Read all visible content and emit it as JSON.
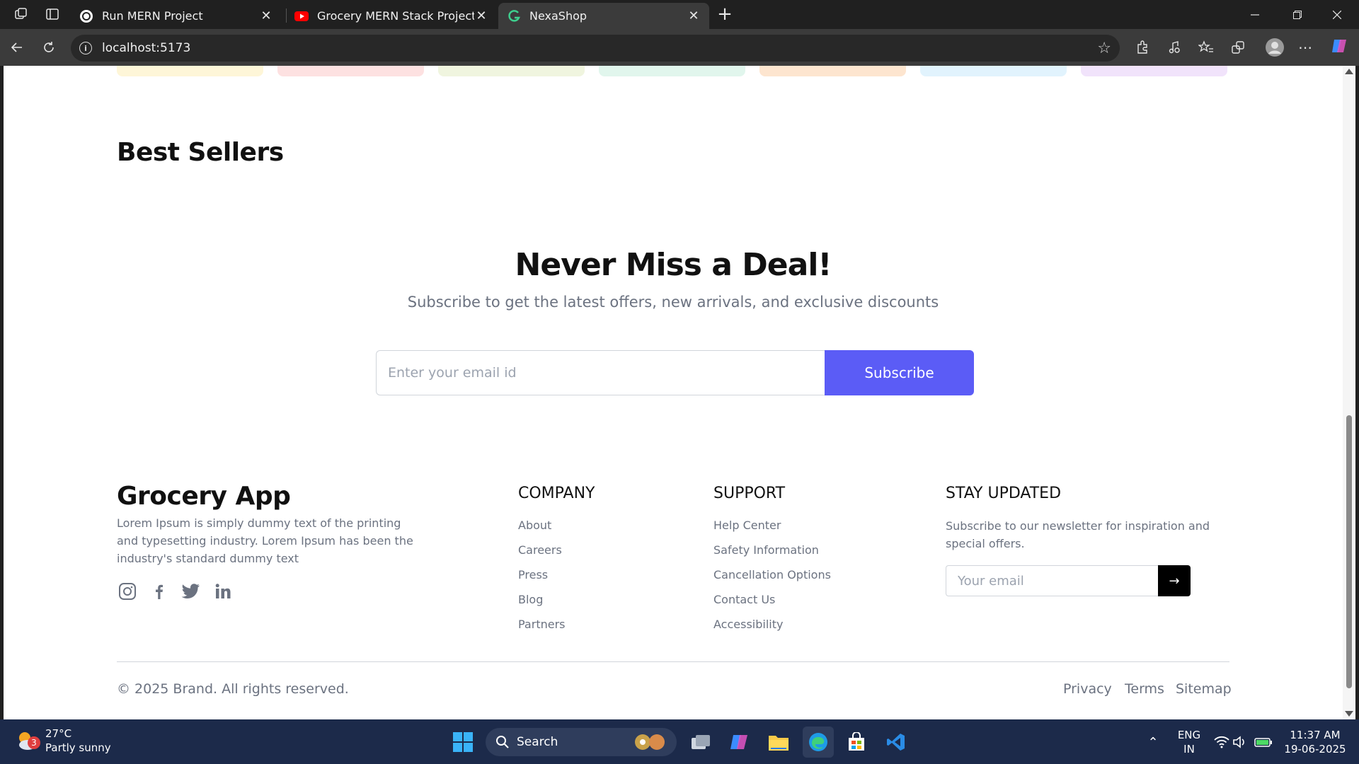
{
  "browser": {
    "tabs": [
      {
        "title": "Run MERN Project",
        "icon": "chatgpt-icon"
      },
      {
        "title": "Grocery MERN Stack Project Full",
        "icon": "youtube-icon"
      },
      {
        "title": "NexaShop",
        "icon": "nexashop-icon",
        "active": true
      }
    ],
    "url": "localhost:5173"
  },
  "page": {
    "best_sellers_heading": "Best Sellers",
    "newsletter": {
      "heading": "Never Miss a Deal!",
      "subheading": "Subscribe to get the latest offers, new arrivals, and exclusive discounts",
      "email_placeholder": "Enter your email id",
      "subscribe_label": "Subscribe",
      "accent_color": "#5b5cf6"
    },
    "category_card_colors": [
      "#fef6d8",
      "#fde1e1",
      "#f0f5df",
      "#e1f6ed",
      "#fde5cf",
      "#e1f3fd",
      "#f1e3fb"
    ]
  },
  "footer": {
    "brand": "Grocery App",
    "description": "Lorem Ipsum is simply dummy text of the printing and typesetting industry. Lorem Ipsum has been the industry's standard dummy text",
    "social": [
      "instagram-icon",
      "facebook-icon",
      "twitter-icon",
      "linkedin-icon"
    ],
    "company": {
      "heading": "COMPANY",
      "links": [
        "About",
        "Careers",
        "Press",
        "Blog",
        "Partners"
      ]
    },
    "support": {
      "heading": "SUPPORT",
      "links": [
        "Help Center",
        "Safety Information",
        "Cancellation Options",
        "Contact Us",
        "Accessibility"
      ]
    },
    "stay_updated": {
      "heading": "STAY UPDATED",
      "description": "Subscribe to our newsletter for inspiration and special offers.",
      "email_placeholder": "Your email",
      "submit_icon": "arrow-right-icon"
    },
    "copyright": "© 2025 Brand. All rights reserved.",
    "bottom_links": [
      "Privacy",
      "Terms",
      "Sitemap"
    ]
  },
  "taskbar": {
    "weather": {
      "temp": "27°C",
      "condition": "Partly sunny",
      "badge": "3"
    },
    "search_label": "Search",
    "language": {
      "line1": "ENG",
      "line2": "IN"
    },
    "time": "11:37 AM",
    "date": "19-06-2025"
  }
}
